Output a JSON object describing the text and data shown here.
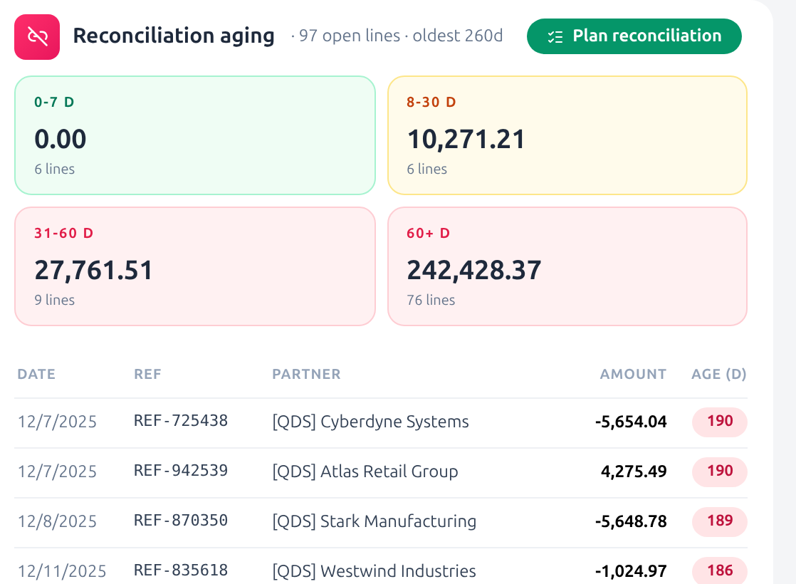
{
  "header": {
    "title": "Reconciliation aging",
    "summary": "· 97 open lines · oldest 260d",
    "action": "Plan reconciliation"
  },
  "buckets": [
    {
      "label": "0-7 D",
      "amount": "0.00",
      "count": "6 lines",
      "kind": "ok"
    },
    {
      "label": "8-30 D",
      "amount": "10,271.21",
      "count": "6 lines",
      "kind": "warn"
    },
    {
      "label": "31-60 D",
      "amount": "27,761.51",
      "count": "9 lines",
      "kind": "risk"
    },
    {
      "label": "60+ D",
      "amount": "242,428.37",
      "count": "76 lines",
      "kind": "risk"
    }
  ],
  "table": {
    "columns": [
      "DATE",
      "REF",
      "PARTNER",
      "AMOUNT",
      "AGE (D)"
    ],
    "rows": [
      {
        "date": "12/7/2025",
        "ref": "REF-725438",
        "partner": "[QDS] Cyberdyne Systems",
        "amount": "-5,654.04",
        "age": "190"
      },
      {
        "date": "12/7/2025",
        "ref": "REF-942539",
        "partner": "[QDS] Atlas Retail Group",
        "amount": "4,275.49",
        "age": "190"
      },
      {
        "date": "12/8/2025",
        "ref": "REF-870350",
        "partner": "[QDS] Stark Manufacturing",
        "amount": "-5,648.78",
        "age": "189"
      },
      {
        "date": "12/11/2025",
        "ref": "REF-835618",
        "partner": "[QDS] Westwind Industries",
        "amount": "-1,024.97",
        "age": "186"
      }
    ]
  }
}
